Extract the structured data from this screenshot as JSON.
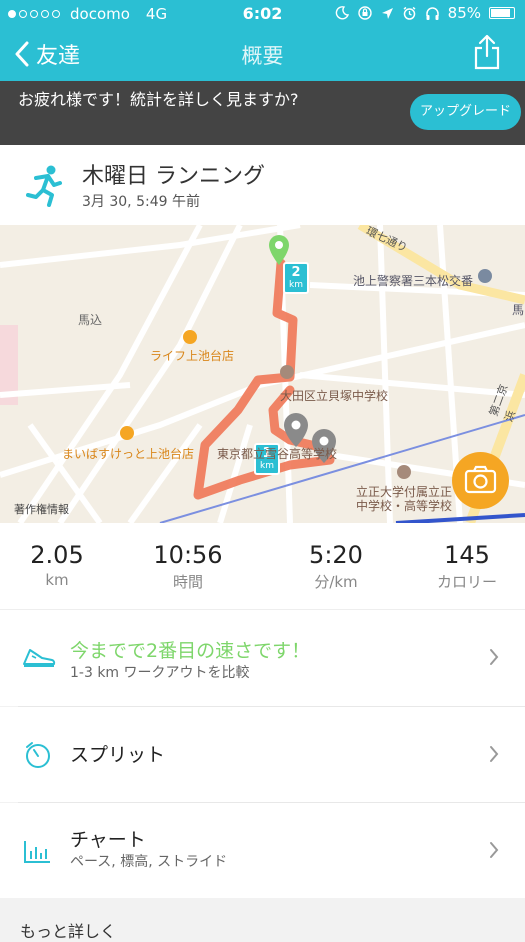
{
  "status_bar": {
    "carrier": "docomo",
    "network": "4G",
    "time": "6:02",
    "battery": "85%",
    "battery_level": 0.85
  },
  "nav": {
    "back_label": "友達",
    "title": "概要"
  },
  "banner": {
    "message": "お疲れ様です！統計を詳しく見ますか?",
    "button_label": "アップグレード"
  },
  "workout": {
    "title": "木曜日 ランニング",
    "datetime": "3月 30, 5:49 午前"
  },
  "map": {
    "labels": {
      "street": "環七通り",
      "police": "池上警察署三本松交番",
      "magome": "馬込",
      "life": "ライフ上池台店",
      "school1": "大田区立貝塚中学校",
      "mybasket": "まいばすけっと上池台店",
      "school2": "東京都立雪谷高等学校",
      "school3": "立正大学付属立正中学校・高等学校",
      "keihin": "第二京浜",
      "copyright": "著作権情報",
      "edge": "馬"
    },
    "markers": [
      {
        "number": "2",
        "unit": "km"
      },
      {
        "number": "1",
        "unit": "km"
      }
    ]
  },
  "stats": [
    {
      "value": "2.05",
      "label": "km"
    },
    {
      "value": "10:56",
      "label": "時間"
    },
    {
      "value": "5:20",
      "label": "分/km"
    },
    {
      "value": "145",
      "label": "カロリー"
    }
  ],
  "rows": {
    "compare": {
      "title": "今までで2番目の速さです！",
      "subtitle": "1-3 km ワークアウトを比較"
    },
    "splits": {
      "title": "スプリット"
    },
    "charts": {
      "title": "チャート",
      "subtitle": "ペース, 標高, ストライド"
    }
  },
  "more": {
    "label": "もっと詳しく"
  },
  "colors": {
    "accent": "#2bbfd3",
    "route": "#f07a5a",
    "compare_green": "#7ed66b",
    "camera": "#f5a623"
  }
}
